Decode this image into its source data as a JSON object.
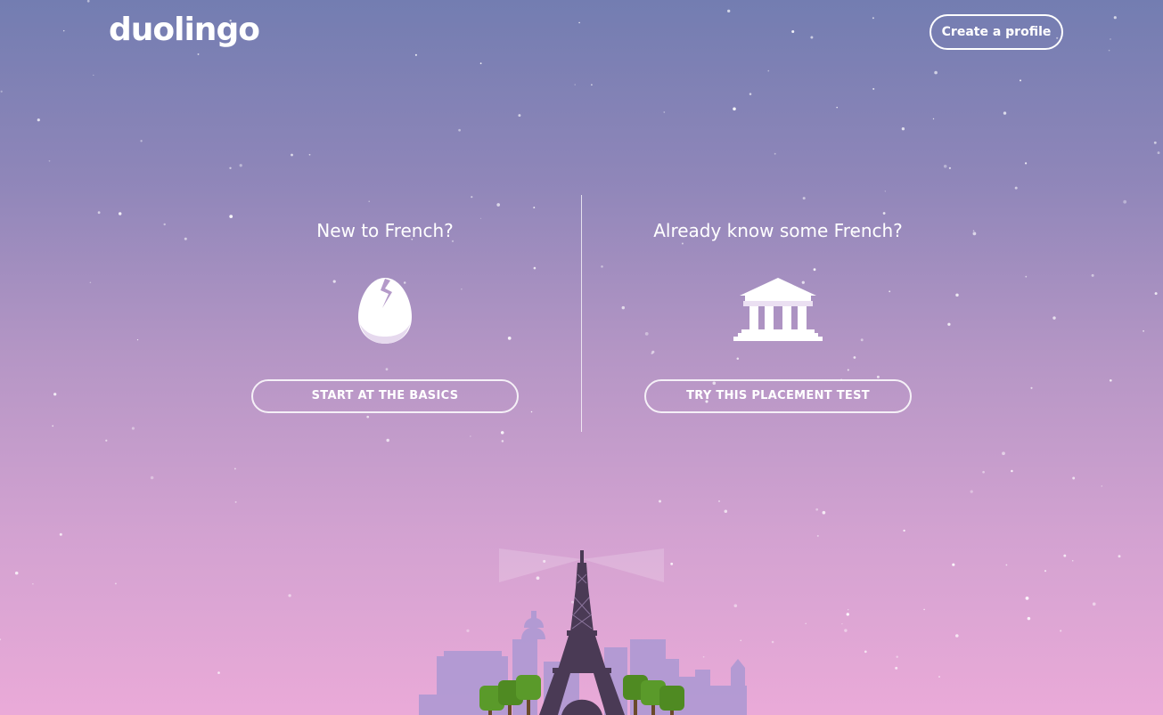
{
  "header": {
    "logo_text": "duolingo",
    "create_profile_label": "Create a profile"
  },
  "options": {
    "new": {
      "title": "New to French?",
      "icon": "cracked-egg-icon",
      "button_label": "START AT THE BASICS"
    },
    "experienced": {
      "title": "Already know some French?",
      "icon": "museum-icon",
      "button_label": "TRY THIS PLACEMENT TEST"
    }
  },
  "illustration": {
    "subject": "eiffel-tower-paris-skyline"
  },
  "colors": {
    "sky_top": "#737db1",
    "sky_bottom": "#eaaad8",
    "tower": "#4a3a55",
    "trees": "#5a9a2a",
    "buildings": "#a996d0"
  }
}
